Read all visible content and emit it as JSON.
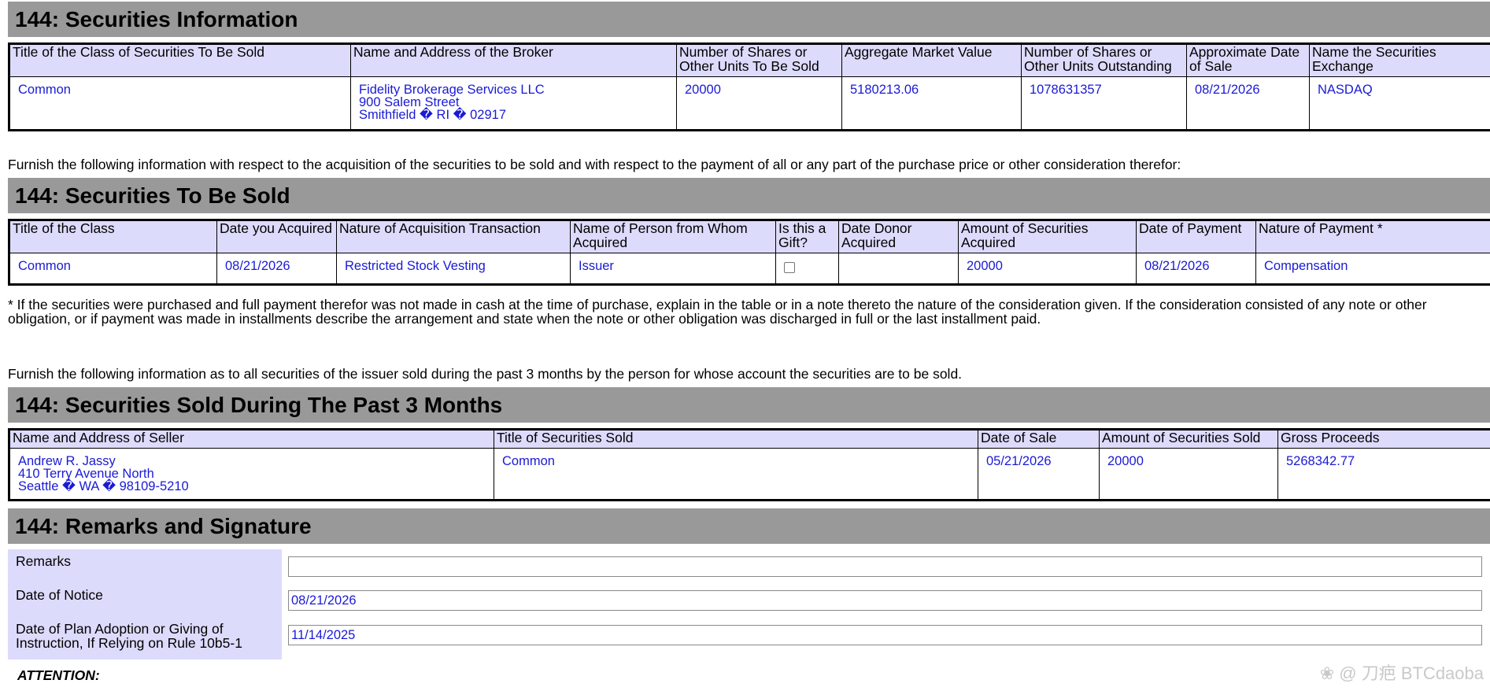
{
  "sections": {
    "info": "144: Securities Information",
    "sold": "144: Securities To Be Sold",
    "past": "144: Securities Sold During The Past 3 Months",
    "remarks": "144: Remarks and Signature"
  },
  "info_table": {
    "headers": [
      "Title of the Class of Securities To Be Sold",
      "Name and Address of the Broker",
      "Number of Shares or Other Units To Be Sold",
      "Aggregate Market Value",
      "Number of Shares or Other Units Outstanding",
      "Approximate Date of Sale",
      "Name the Securities Exchange"
    ],
    "row": {
      "title": "Common",
      "broker": [
        "Fidelity Brokerage Services LLC",
        "900 Salem Street",
        "Smithfield � RI � 02917"
      ],
      "shares": "20000",
      "market_value": "5180213.06",
      "outstanding": "1078631357",
      "date": "08/21/2026",
      "exchange": "NASDAQ"
    }
  },
  "furnish_1": "Furnish the following information with respect to the acquisition of the securities to be sold and with respect to the payment of all or any part of the purchase price or other consideration therefor:",
  "sold_table": {
    "headers": [
      "Title of the Class",
      "Date you Acquired",
      "Nature of Acquisition Transaction",
      "Name of Person from Whom Acquired",
      "Is this a Gift?",
      "Date Donor Acquired",
      "Amount of Securities Acquired",
      "Date of Payment",
      "Nature of Payment *"
    ],
    "row": {
      "title": "Common",
      "date_acquired": "08/21/2026",
      "nature": "Restricted Stock Vesting",
      "person": "Issuer",
      "gift": false,
      "donor_date": "",
      "amount": "20000",
      "payment_date": "08/21/2026",
      "payment_nature": "Compensation"
    }
  },
  "footnote": "* If the securities were purchased and full payment therefor was not made in cash at the time of purchase, explain in the table or in a note thereto the nature of the consideration given. If the consideration consisted of any note or other obligation, or if payment was made in installments describe the arrangement and state when the note or other obligation was discharged in full or the last installment paid.",
  "furnish_2": "Furnish the following information as to all securities of the issuer sold during the past 3 months by the person for whose account the securities are to be sold.",
  "past_table": {
    "headers": [
      "Name and Address of Seller",
      "Title of Securities Sold",
      "Date of Sale",
      "Amount of Securities Sold",
      "Gross Proceeds"
    ],
    "row": {
      "seller": [
        "Andrew R. Jassy",
        "410 Terry Avenue North",
        "Seattle � WA � 98109-5210"
      ],
      "title": "Common",
      "date": "05/21/2026",
      "amount": "20000",
      "proceeds": "5268342.77"
    }
  },
  "remarks": {
    "remarks_label": "Remarks",
    "remarks_value": "",
    "notice_label": "Date of Notice",
    "notice_value": "08/21/2026",
    "plan_label": "Date of Plan Adoption or Giving of Instruction, If Relying on Rule 10b5-1",
    "plan_value": "11/14/2025"
  },
  "attention": "ATTENTION:",
  "watermark": "❀ @ 刀疤 BTCdaoba"
}
